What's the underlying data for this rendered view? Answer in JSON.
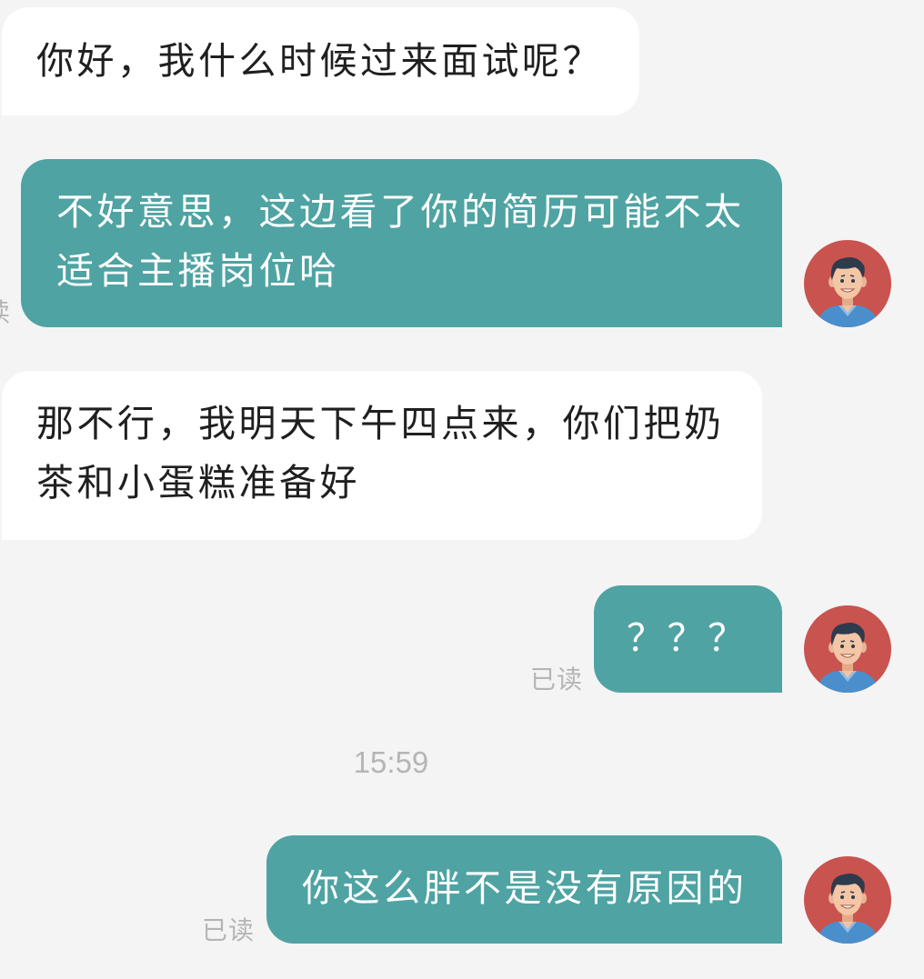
{
  "colors": {
    "background": "#f4f4f4",
    "incoming_bubble": "#ffffff",
    "incoming_text": "#1f1f1f",
    "outgoing_bubble": "#4fa3a3",
    "outgoing_text": "#ffffff",
    "meta_text": "#b5b5b5",
    "avatar_background": "#c9534f"
  },
  "messages": [
    {
      "direction": "incoming",
      "text": "你好，我什么时候过来面试呢？"
    },
    {
      "direction": "outgoing",
      "text": "不好意思，这边看了你的简历可能不太适合主播岗位哈",
      "status": "已读",
      "avatar_icon": "man-avatar-icon"
    },
    {
      "direction": "incoming",
      "text": "那不行，我明天下午四点来，你们把奶茶和小蛋糕准备好"
    },
    {
      "direction": "outgoing",
      "text": "？？？",
      "status": "已读",
      "avatar_icon": "man-avatar-icon"
    },
    {
      "direction": "outgoing",
      "text": "你这么胖不是没有原因的",
      "status": "已读",
      "avatar_icon": "man-avatar-icon"
    }
  ],
  "time_separator": "15:59"
}
